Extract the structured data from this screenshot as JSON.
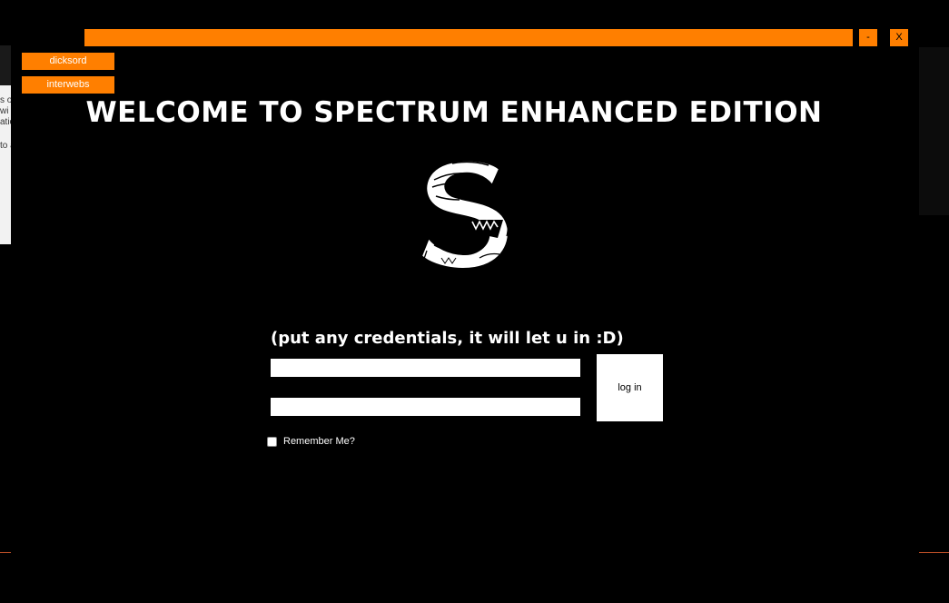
{
  "background": {
    "fragments": [
      "s o",
      "wi",
      "atio",
      "to a"
    ]
  },
  "window": {
    "minimize_label": "-",
    "close_label": "X"
  },
  "side_buttons": [
    {
      "label": "dicksord"
    },
    {
      "label": "interwebs"
    }
  ],
  "welcome_title": "WELCOME TO SPECTRUM ENHANCED EDITION",
  "logo": {
    "icon": "spectrum-s-logo-icon"
  },
  "login": {
    "hint": "(put any credentials, it will let u in :D)",
    "username_value": "",
    "password_value": "",
    "button_label": "log in",
    "remember_label": "Remember Me?",
    "remember_checked": false
  },
  "colors": {
    "accent": "#ff7f00",
    "background": "#000000",
    "text": "#ffffff"
  }
}
